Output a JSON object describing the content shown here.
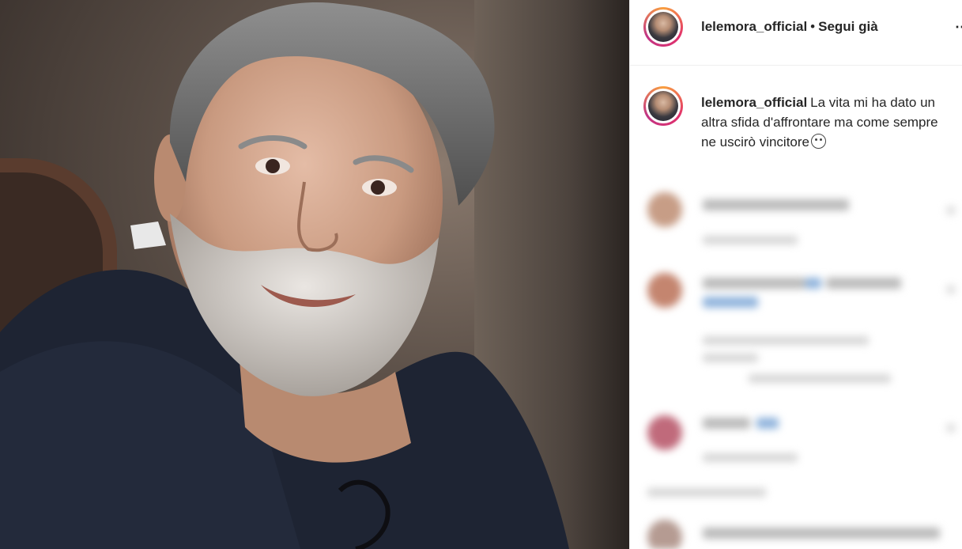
{
  "post": {
    "username": "lelemora_official",
    "separator": "•",
    "follow_status": "Segui già",
    "more_icon": "⋯",
    "caption_text": "La vita mi ha dato un altra sfida d'affrontare ma come sempre ne uscirò vincitore",
    "caption_emoji": "smirking-face-emoji"
  },
  "colors": {
    "story_ring_start": "#f9a03f",
    "story_ring_end": "#c13584",
    "text": "#262626",
    "divider": "#efefef"
  }
}
